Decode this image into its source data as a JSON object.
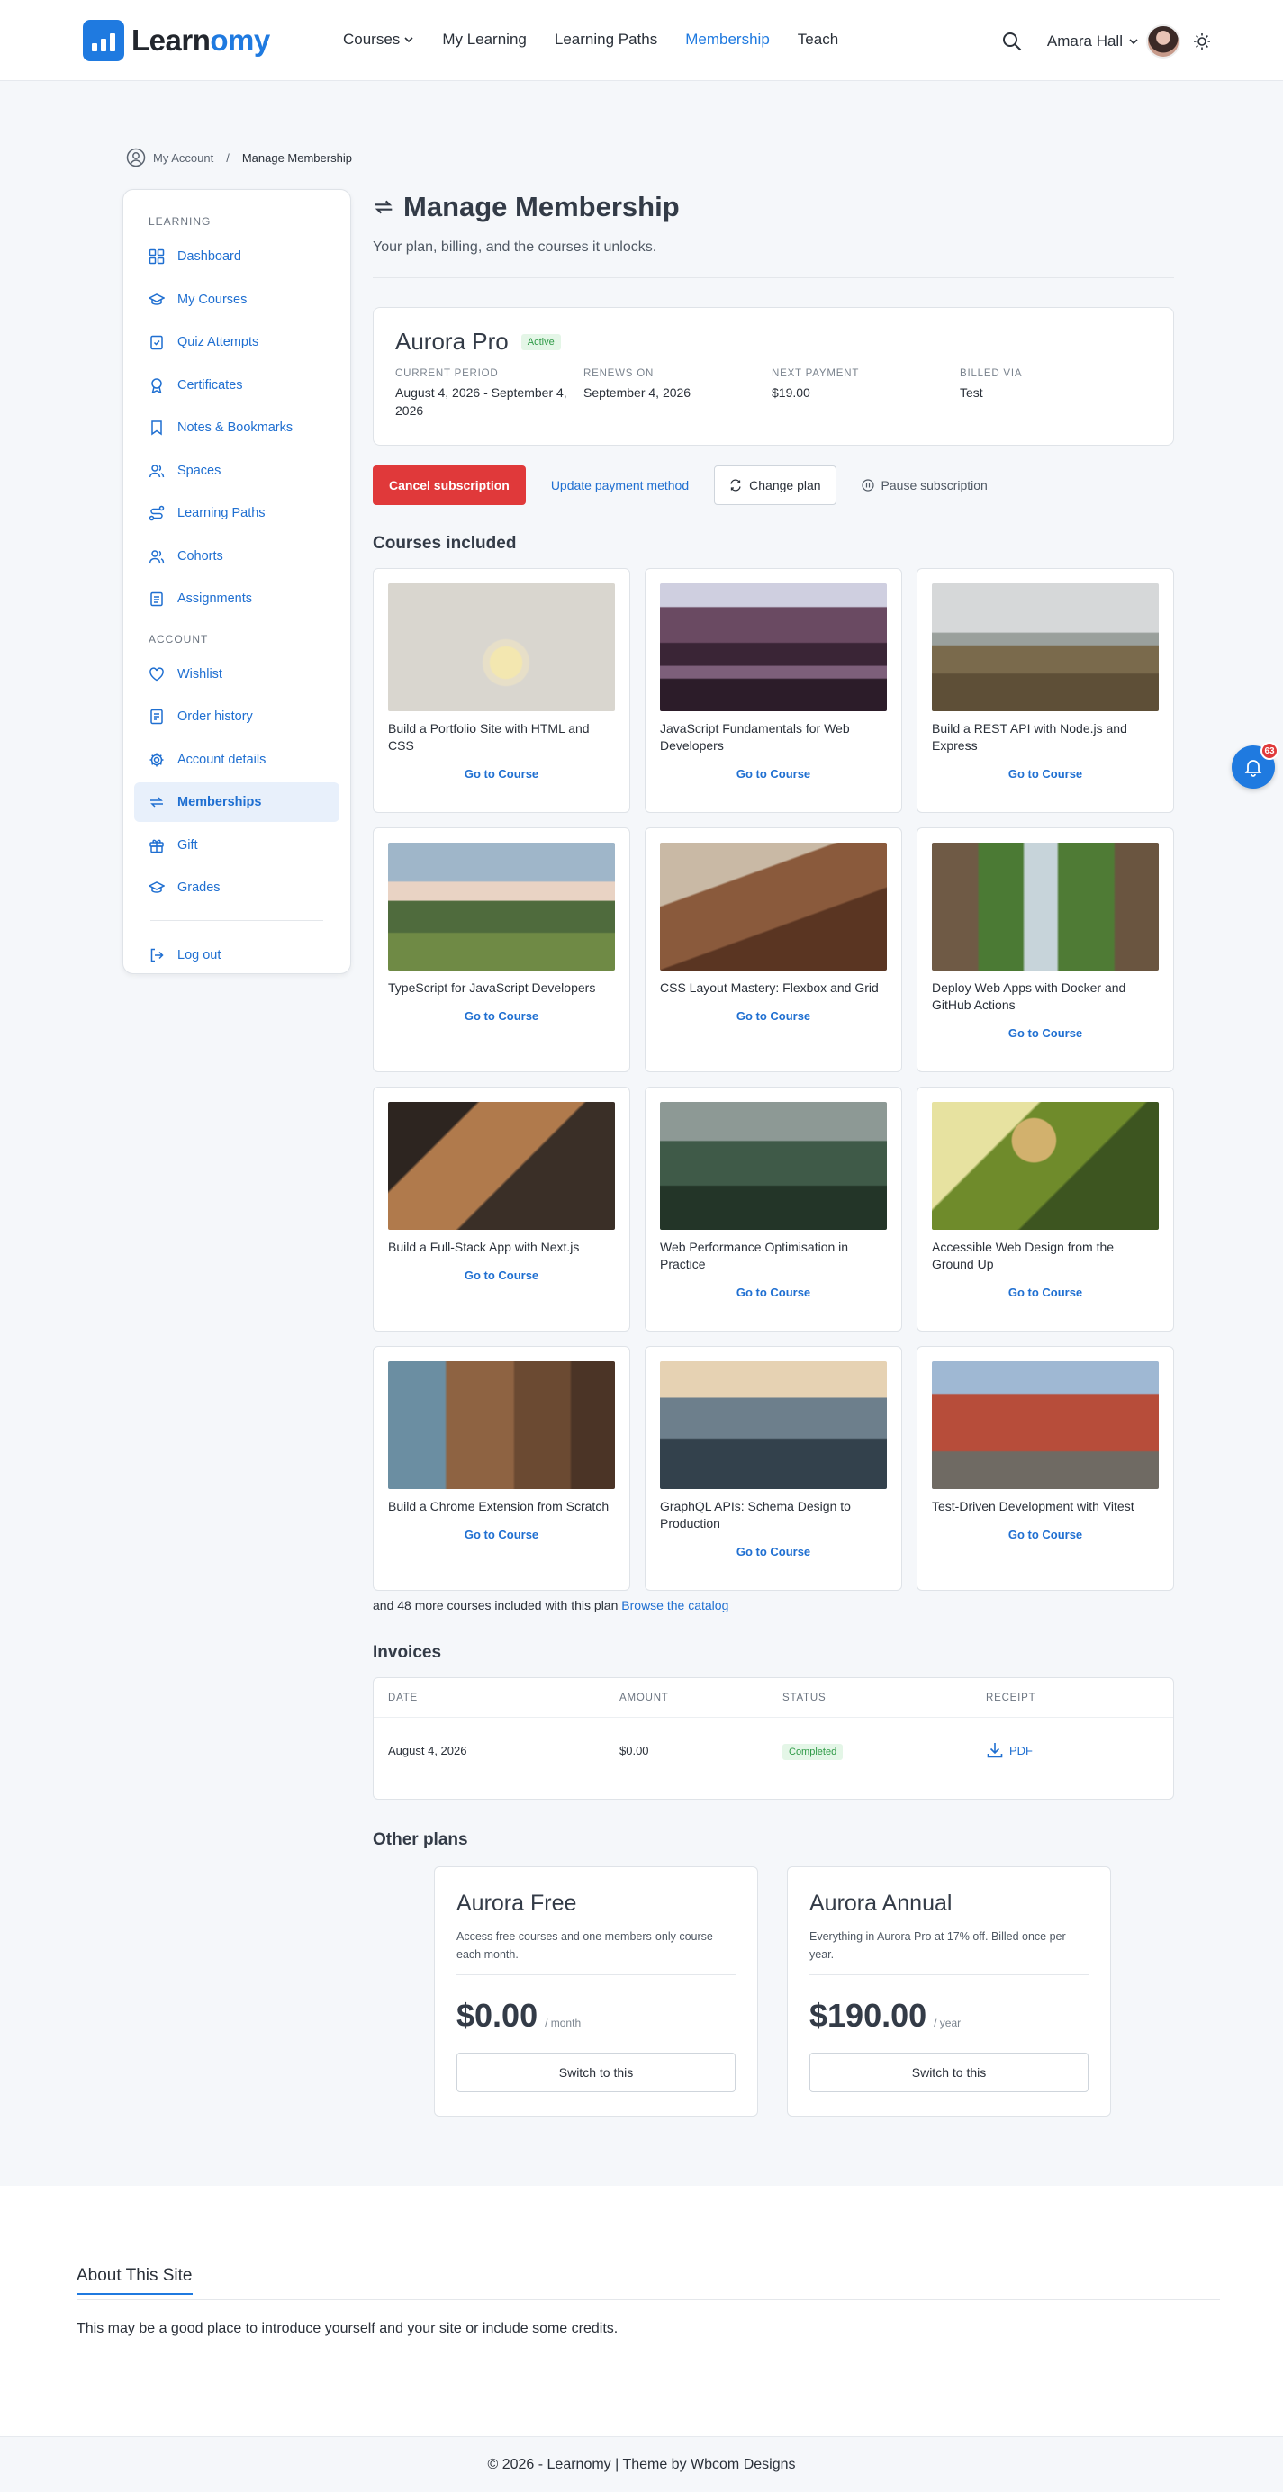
{
  "header": {
    "logo": {
      "part1": "Learn",
      "part2": "omy"
    },
    "nav": [
      {
        "label": "Courses",
        "has_dropdown": true
      },
      {
        "label": "My Learning"
      },
      {
        "label": "Learning Paths"
      },
      {
        "label": "Membership",
        "active": true
      },
      {
        "label": "Teach"
      }
    ],
    "user_name": "Amara Hall"
  },
  "breadcrumb": {
    "root": "My Account",
    "current": "Manage Membership"
  },
  "sidebar": {
    "section_learning": "Learning",
    "learning_items": [
      "Dashboard",
      "My Courses",
      "Quiz Attempts",
      "Certificates",
      "Notes & Bookmarks",
      "Spaces",
      "Learning Paths",
      "Cohorts",
      "Assignments"
    ],
    "section_account": "Account",
    "account_items": [
      "Wishlist",
      "Order history",
      "Account details",
      "Memberships",
      "Gift",
      "Grades"
    ],
    "logout": "Log out"
  },
  "page": {
    "title": "Manage Membership",
    "subtitle": "Your plan, billing, and the courses it unlocks."
  },
  "plan": {
    "name": "Aurora Pro",
    "status": "Active",
    "meta": [
      {
        "label": "Current period",
        "value": "August 4, 2026 - September 4, 2026"
      },
      {
        "label": "Renews on",
        "value": "September 4, 2026"
      },
      {
        "label": "Next payment",
        "value": "$19.00"
      },
      {
        "label": "Billed via",
        "value": "Test"
      }
    ]
  },
  "actions": {
    "cancel": "Cancel subscription",
    "update_payment": "Update payment method",
    "change_plan": "Change plan",
    "pause": "Pause subscription"
  },
  "courses": {
    "title": "Courses included",
    "cta": "Go to Course",
    "items": [
      "Build a Portfolio Site with HTML and CSS",
      "JavaScript Fundamentals for Web Developers",
      "Build a REST API with Node.js and Express",
      "TypeScript for JavaScript Developers",
      "CSS Layout Mastery: Flexbox and Grid",
      "Deploy Web Apps with Docker and GitHub Actions",
      "Build a Full-Stack App with Next.js",
      "Web Performance Optimisation in Practice",
      "Accessible Web Design from the Ground Up",
      "Build a Chrome Extension from Scratch",
      "GraphQL APIs: Schema Design to Production",
      "Test-Driven Development with Vitest"
    ],
    "more_text": "and 48 more courses included with this plan",
    "more_link": "Browse the catalog"
  },
  "invoices": {
    "title": "Invoices",
    "columns": [
      "Date",
      "Amount",
      "Status",
      "Receipt"
    ],
    "rows": [
      {
        "date": "August 4, 2026",
        "amount": "$0.00",
        "status": "Completed",
        "receipt": "PDF"
      }
    ]
  },
  "other_plans": {
    "title": "Other plans",
    "items": [
      {
        "name": "Aurora Free",
        "desc": "Access free courses and one members-only course each month.",
        "price": "$0.00",
        "period": "/ month",
        "button": "Switch to this"
      },
      {
        "name": "Aurora Annual",
        "desc": "Everything in Aurora Pro at 17% off. Billed once per year.",
        "price": "$190.00",
        "period": "/ year",
        "button": "Switch to this"
      }
    ]
  },
  "notifications": {
    "count": "63"
  },
  "about": {
    "title": "About This Site",
    "text": "This may be a good place to introduce yourself and your site or include some credits."
  },
  "footer": {
    "text": "© 2026 - Learnomy | Theme by Wbcom Designs"
  },
  "colors": {
    "accent": "#1f7ae0",
    "danger": "#e0393a",
    "success": "#2f9a47"
  }
}
